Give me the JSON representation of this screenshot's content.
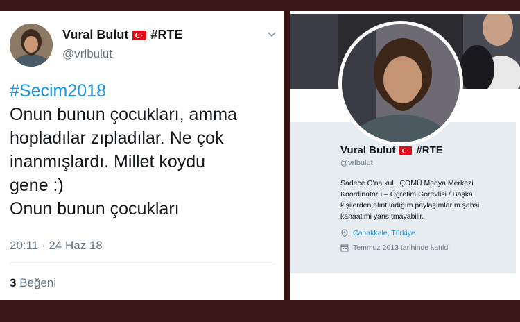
{
  "tweet": {
    "display_name": "Vural Bulut",
    "name_tag": "#RTE",
    "handle": "@vrlbulut",
    "hashtag": "#Secim2018",
    "lines": [
      "Onun bunun çocukları, amma",
      "hopladılar zıpladılar. Ne çok",
      "inanmışlardı. Millet koydu",
      "gene :)",
      "Onun bunun çocukları"
    ],
    "timestamp": "20:11 · 24 Haz 18",
    "likes_count": "3",
    "likes_label": "Beğeni"
  },
  "profile": {
    "display_name": "Vural Bulut",
    "name_tag": "#RTE",
    "handle": "@vrlbulut",
    "bio_lines": [
      "Sadece O'na kul.. ÇOMÜ Medya Merkezi",
      "Koordinatörü – Öğretim Görevlisi / Başka",
      "kişilerden alıntıladığım paylaşımlarım şahsi",
      "kanaatimi yansıtmayabilir."
    ],
    "location": "Çanakkale, Türkiye",
    "joined": "Temmuz 2013 tarihinde katıldı"
  },
  "colors": {
    "link": "#1b95e0",
    "secondary_text": "#657786",
    "primary_text": "#14171a",
    "flag_red": "#e30a17",
    "frame": "#3b1616"
  },
  "icons": {
    "flag": "turkey-flag-icon",
    "chevron": "chevron-down-icon",
    "location": "location-pin-icon",
    "calendar": "calendar-icon"
  }
}
